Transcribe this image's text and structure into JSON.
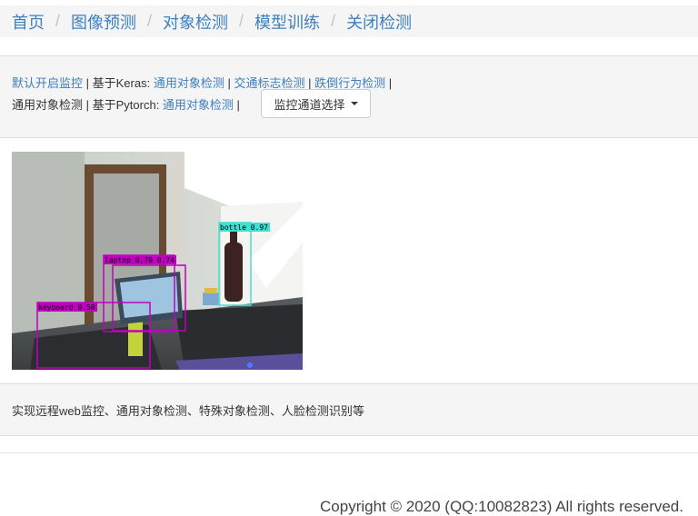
{
  "nav": {
    "items": [
      "首页",
      "图像预测",
      "对象检测",
      "模型训练",
      "关闭检测"
    ],
    "separator": "/"
  },
  "links": {
    "line1": {
      "default_monitor": "默认开启监控",
      "sep": " | ",
      "keras_prefix": "基于Keras: ",
      "keras_general": "通用对象检测",
      "keras_traffic": "交通标志检测",
      "keras_fall": "跌倒行为检测",
      "end": " |"
    },
    "line2": {
      "current": "通用对象检测",
      "sep": " | ",
      "pytorch_prefix": "基于Pytorch: ",
      "pytorch_general": "通用对象检测",
      "end": " |"
    },
    "dropdown_label": "监控通道选择"
  },
  "detections": [
    {
      "label": "bottle 0.97",
      "color": "#40e0d0"
    },
    {
      "label": "laptop 0.70 0.74",
      "color": "#c000c0"
    },
    {
      "label": "keyboard 0.50",
      "color": "#c000c0"
    }
  ],
  "description": "实现远程web监控、通用对象检测、特殊对象检测、人脸检测识别等",
  "footer": {
    "copyright": "Copyright © 2020 (QQ:10082823) All rights reserved."
  }
}
